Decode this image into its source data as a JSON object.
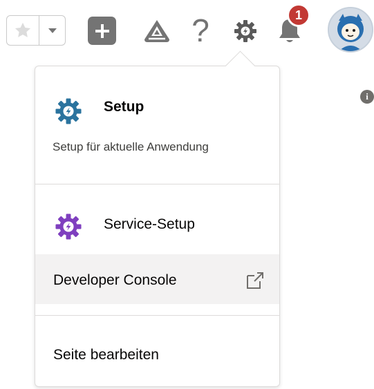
{
  "header": {
    "favorites_star_icon": "star-icon",
    "favorites_dropdown_icon": "caret-down-icon",
    "global_actions_icon": "plus-icon",
    "trailhead_icon": "trailhead-icon",
    "help_glyph": "?",
    "setup_icon": "gear-icon",
    "notifications_icon": "bell-icon",
    "notification_count": "1",
    "avatar_icon": "astro-avatar-icon"
  },
  "page": {
    "info_glyph": "i"
  },
  "setup_menu": {
    "setup": {
      "title": "Setup",
      "subtitle": "Setup für aktuelle Anwendung",
      "icon_color": "#2a739e"
    },
    "service_setup": {
      "label": "Service-Setup",
      "icon_color": "#7f3fbf"
    },
    "developer_console": {
      "label": "Developer Console",
      "external_icon": "external-link-icon"
    },
    "edit_page": {
      "label": "Seite bearbeiten"
    }
  },
  "colors": {
    "icon_gray": "#747474",
    "badge_red": "#c23934",
    "hover_bg": "#f3f2f2",
    "border": "#dddbda"
  }
}
